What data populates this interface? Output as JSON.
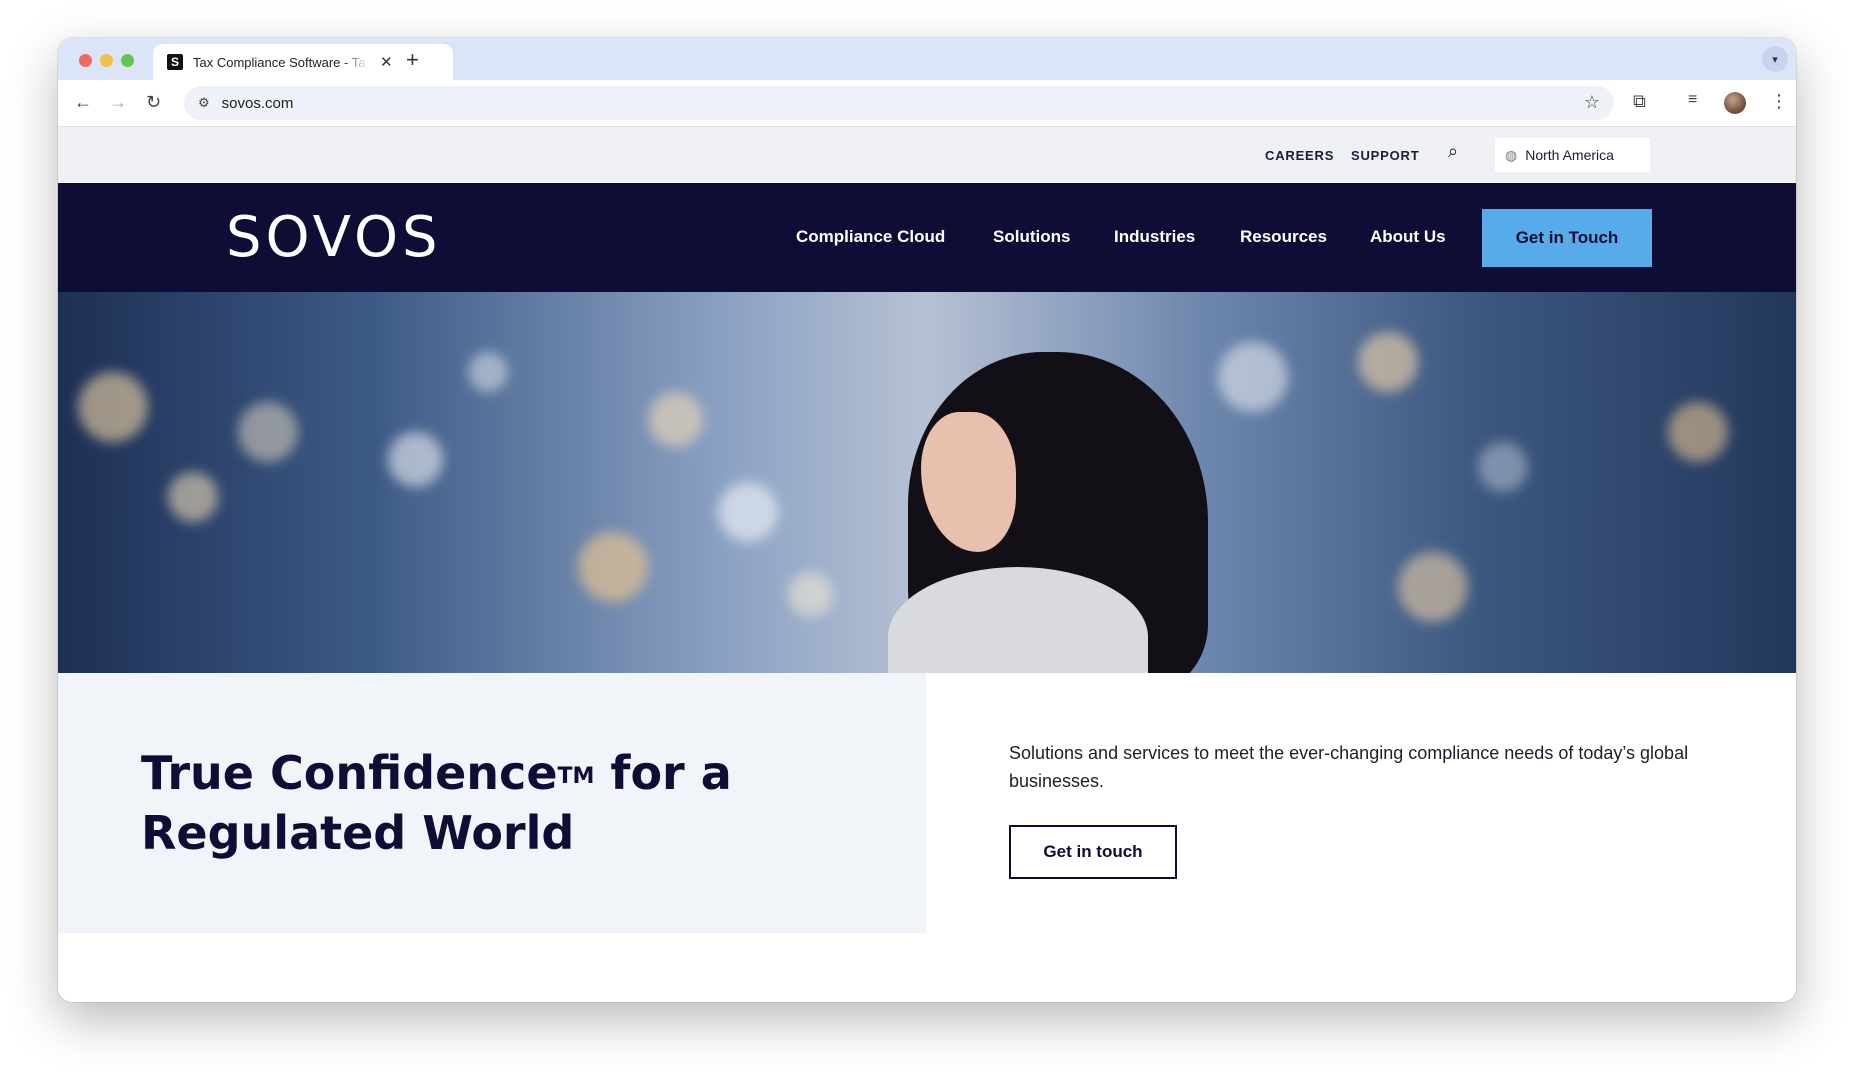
{
  "browser": {
    "tab_title": "Tax Compliance Software - Tax",
    "favicon_letter": "S",
    "tab_close": "✕",
    "new_tab": "+",
    "url": "sovos.com"
  },
  "utility": {
    "careers": "CAREERS",
    "support": "SUPPORT",
    "region": "North America"
  },
  "nav": {
    "logo": "SOVOS",
    "items": [
      "Compliance Cloud",
      "Solutions",
      "Industries",
      "Resources",
      "About Us"
    ],
    "cta": "Get in Touch"
  },
  "content": {
    "headline_part1": "True Confidence",
    "headline_tm": "TM",
    "headline_part2": " for a Regulated World",
    "description": "Solutions and services to meet the ever-changing compliance needs of today’s global businesses.",
    "button": "Get in touch"
  },
  "colors": {
    "nav_bg": "#0e0d35",
    "cta_bg": "#57abe9",
    "utility_bg": "#eef0f4",
    "content_left_bg": "#f1f4f8"
  }
}
